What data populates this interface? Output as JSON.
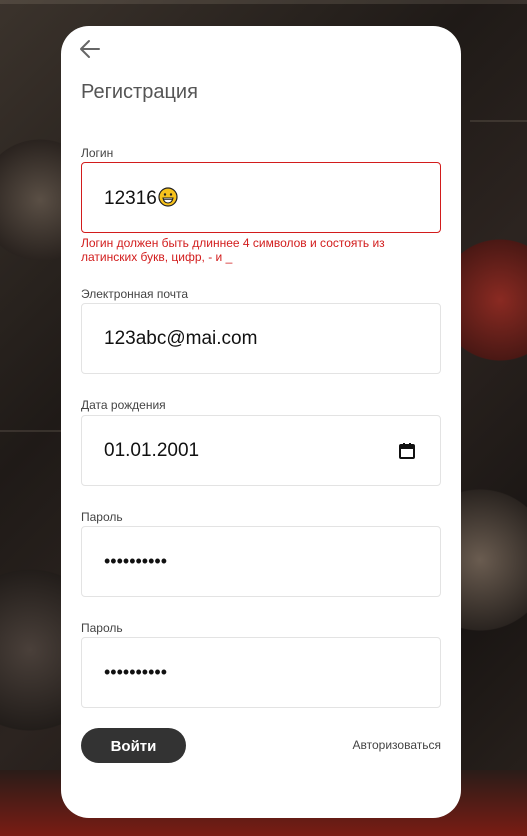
{
  "form": {
    "title": "Регистрация",
    "login": {
      "label": "Логин",
      "value": "12316",
      "emoji": "grinning-face",
      "error": "Логин должен быть длиннее 4 символов и состоять из латинских букв, цифр, - и _"
    },
    "email": {
      "label": "Электронная почта",
      "value": "123abc@mai.com"
    },
    "birthdate": {
      "label": "Дата рождения",
      "value": "01.01.2001",
      "icon": "calendar-icon"
    },
    "password": {
      "label": "Пароль",
      "value": "••••••••••"
    },
    "password_confirm": {
      "label": "Пароль",
      "value": "••••••••••"
    },
    "submit_label": "Войти",
    "auth_link": "Авторизоваться"
  },
  "colors": {
    "error": "#d21c1c",
    "button_bg": "#333333",
    "card_bg": "#ffffff"
  },
  "icons": {
    "back": "arrow-left-icon"
  }
}
